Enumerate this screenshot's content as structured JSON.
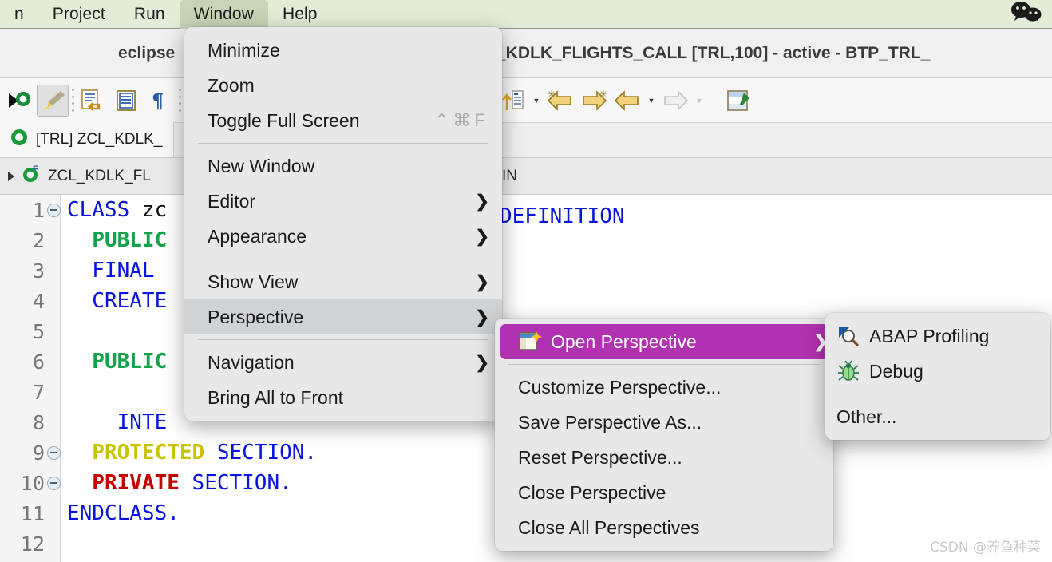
{
  "menubar": {
    "items": [
      {
        "label": "n",
        "active": false
      },
      {
        "label": "Project",
        "active": false
      },
      {
        "label": "Run",
        "active": false
      },
      {
        "label": "Window",
        "active": true
      },
      {
        "label": "Help",
        "active": false
      }
    ],
    "status_icon": "wechat-icon",
    "background": "#e3ecd6",
    "active_background": "#c7d4b6"
  },
  "window": {
    "title_left": "eclipse",
    "title_right": "_KDLK_FLIGHTS_CALL [TRL,100] - active - BTP_TRL_"
  },
  "tabbar": {
    "tabs": [
      {
        "label": "[TRL] ZCL_KDLK_",
        "icon": "abap-class-icon"
      }
    ]
  },
  "breadcrumb": {
    "item_label": "ZCL_KDLK_FL",
    "item_icon": "abap-class-form-icon",
    "right_label": "SSRUN~MAIN"
  },
  "editor": {
    "lines": [
      {
        "num": "1",
        "fold": true,
        "segments": [
          {
            "text": "CLASS ",
            "style": "kw-blue"
          },
          {
            "text": "zc",
            "style": "kw-plain"
          }
        ]
      },
      {
        "num": "2",
        "fold": false,
        "segments": [
          {
            "text": "  PUBLIC",
            "style": "kw-green"
          }
        ]
      },
      {
        "num": "3",
        "fold": false,
        "segments": [
          {
            "text": "  FINAL",
            "style": "kw-blue"
          }
        ]
      },
      {
        "num": "4",
        "fold": false,
        "segments": [
          {
            "text": "  CREATE",
            "style": "kw-blue"
          }
        ]
      },
      {
        "num": "5",
        "fold": false,
        "segments": [
          {
            "text": "",
            "style": "kw-plain"
          }
        ]
      },
      {
        "num": "6",
        "fold": false,
        "segments": [
          {
            "text": "  PUBLIC",
            "style": "kw-green"
          }
        ]
      },
      {
        "num": "7",
        "fold": false,
        "segments": [
          {
            "text": "",
            "style": "kw-plain"
          }
        ]
      },
      {
        "num": "8",
        "fold": false,
        "segments": [
          {
            "text": "    INTE",
            "style": "kw-blue"
          }
        ]
      },
      {
        "num": "9",
        "fold": true,
        "segments": [
          {
            "text": "  PROTECTED",
            "style": "kw-olive"
          },
          {
            "text": " SECTION.",
            "style": "kw-blue"
          }
        ]
      },
      {
        "num": "10",
        "fold": true,
        "segments": [
          {
            "text": "  PRIVATE",
            "style": "kw-red"
          },
          {
            "text": " SECTION.",
            "style": "kw-blue"
          }
        ]
      },
      {
        "num": "11",
        "fold": false,
        "segments": [
          {
            "text": "ENDCLASS.",
            "style": "kw-blue"
          }
        ]
      },
      {
        "num": "12",
        "fold": false,
        "segments": [
          {
            "text": "",
            "style": "kw-plain"
          }
        ]
      }
    ],
    "line1_tail": "DEFINITION"
  },
  "window_menu": {
    "items": [
      {
        "type": "item",
        "label": "Minimize",
        "shortcut": "",
        "submenu": false,
        "selected": false
      },
      {
        "type": "item",
        "label": "Zoom",
        "shortcut": "",
        "submenu": false,
        "selected": false
      },
      {
        "type": "item",
        "label": "Toggle Full Screen",
        "shortcut": "⌃⌘F",
        "submenu": false,
        "selected": false
      },
      {
        "type": "separator"
      },
      {
        "type": "item",
        "label": "New Window",
        "shortcut": "",
        "submenu": false,
        "selected": false
      },
      {
        "type": "item",
        "label": "Editor",
        "shortcut": "",
        "submenu": true,
        "selected": false
      },
      {
        "type": "item",
        "label": "Appearance",
        "shortcut": "",
        "submenu": true,
        "selected": false
      },
      {
        "type": "separator"
      },
      {
        "type": "item",
        "label": "Show View",
        "shortcut": "",
        "submenu": true,
        "selected": false
      },
      {
        "type": "item",
        "label": "Perspective",
        "shortcut": "",
        "submenu": true,
        "selected": true
      },
      {
        "type": "separator"
      },
      {
        "type": "item",
        "label": "Navigation",
        "shortcut": "",
        "submenu": true,
        "selected": false
      },
      {
        "type": "item",
        "label": "Bring All to Front",
        "shortcut": "",
        "submenu": false,
        "selected": false
      }
    ]
  },
  "perspective_menu": {
    "highlight_color": "#b032b0",
    "items": [
      {
        "type": "highlight",
        "label": "Open Perspective",
        "icon": "open-perspective-icon",
        "submenu": true
      },
      {
        "type": "separator"
      },
      {
        "type": "item",
        "label": "Customize Perspective..."
      },
      {
        "type": "item",
        "label": "Save Perspective As..."
      },
      {
        "type": "item",
        "label": "Reset Perspective..."
      },
      {
        "type": "item",
        "label": "Close Perspective"
      },
      {
        "type": "item",
        "label": "Close All Perspectives"
      }
    ]
  },
  "open_perspective_menu": {
    "items": [
      {
        "type": "item",
        "label": "ABAP Profiling",
        "icon": "abap-profiling-icon"
      },
      {
        "type": "item",
        "label": "Debug",
        "icon": "debug-bug-icon"
      },
      {
        "type": "separator"
      },
      {
        "type": "item",
        "label": "Other...",
        "icon": ""
      }
    ]
  },
  "watermark": {
    "text": "CSDN @养鱼种菜"
  }
}
